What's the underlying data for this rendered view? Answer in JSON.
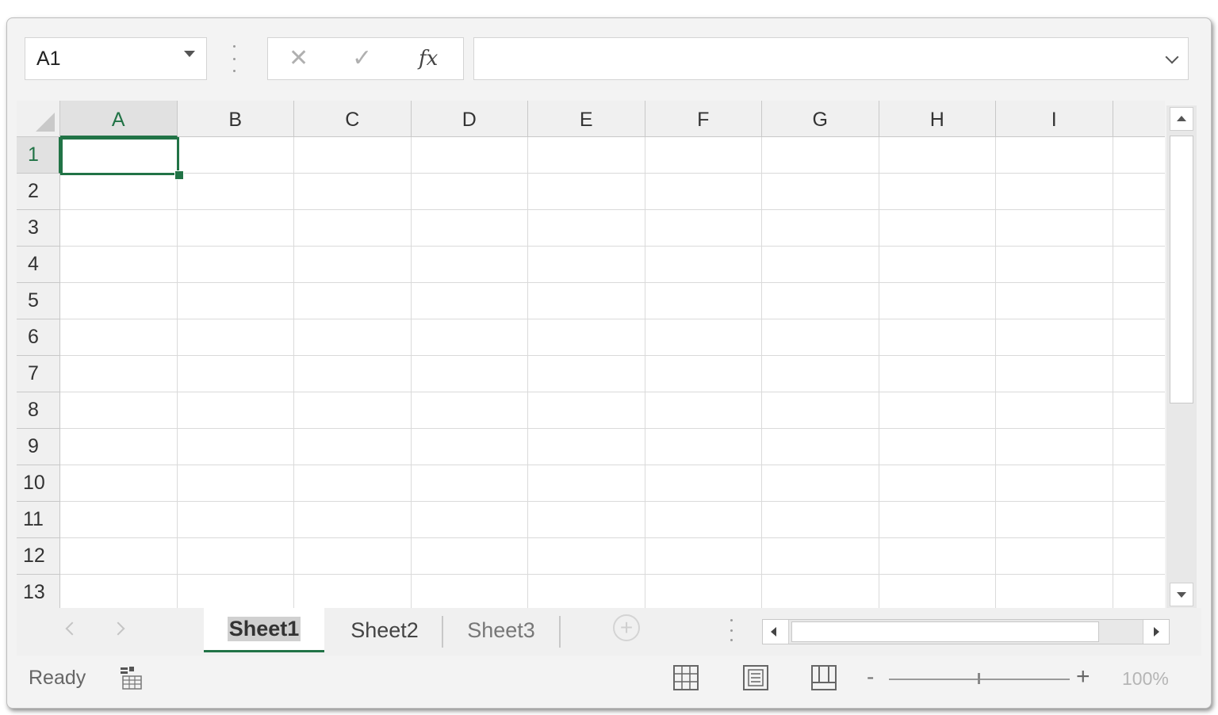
{
  "formula_bar": {
    "name_box": "A1",
    "cancel_icon": "✕",
    "enter_icon": "✓",
    "fx_label": "fx",
    "formula_value": ""
  },
  "grid": {
    "columns": [
      "A",
      "B",
      "C",
      "D",
      "E",
      "F",
      "G",
      "H",
      "I"
    ],
    "rows": [
      "1",
      "2",
      "3",
      "4",
      "5",
      "6",
      "7",
      "8",
      "9",
      "10",
      "11",
      "12",
      "13"
    ],
    "active_cell": "A1",
    "accent_color": "#217346"
  },
  "sheets": {
    "tabs": [
      {
        "label": "Sheet1",
        "active": true
      },
      {
        "label": "Sheet2",
        "active": false
      },
      {
        "label": "Sheet3",
        "active": false
      }
    ],
    "add_sheet_icon": "+"
  },
  "status_bar": {
    "status": "Ready",
    "zoom_minus": "-",
    "zoom_plus": "+",
    "zoom_level": "100%",
    "zoom_percent": 100
  },
  "icons": {
    "macro": "macro-record-icon",
    "normal_view": "normal-view-icon",
    "page_layout": "page-layout-view-icon",
    "page_break": "page-break-preview-icon"
  }
}
